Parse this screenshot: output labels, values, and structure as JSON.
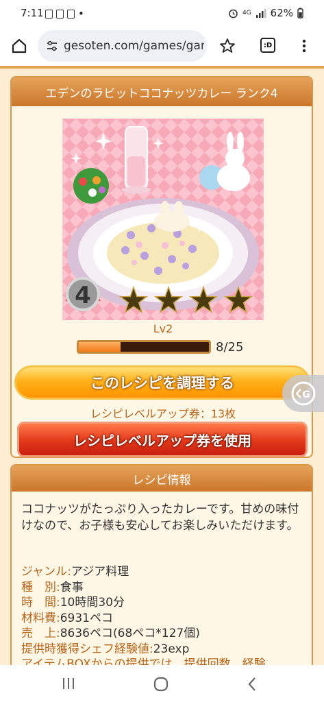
{
  "status": {
    "time": "7:11",
    "dot": "•",
    "network": "4G",
    "battery": "62%"
  },
  "browser": {
    "url": "gesoten.com/games/gar",
    "tabs_icon_label": ":D"
  },
  "recipe": {
    "title": "エデンのラビットココナッツカレー ランク4",
    "rank": "4",
    "stars": 4,
    "level": "Lv2",
    "progress_text": "8/25",
    "progress_fraction": 0.32,
    "cook_button": "このレシピを調理する",
    "ticket_text": "レシピレベルアップ券：13枚",
    "use_button": "レシピレベルアップ券を使用"
  },
  "info": {
    "header": "レシピ情報",
    "description": "ココナッツがたっぷり入ったカレーです。甘めの味付けなので、お子様も安心してお楽しみいただけます。",
    "specs": [
      {
        "label": "ジャンル:",
        "value": "アジア料理"
      },
      {
        "label": "種　別:",
        "value": "食事"
      },
      {
        "label": "時　間:",
        "value": "10時間30分"
      },
      {
        "label": "材料費:",
        "value": "6931ペコ"
      },
      {
        "label": "売　上:",
        "value": "8636ペコ(68ペコ*127個)"
      },
      {
        "label": "提供時獲得シェフ経験値:",
        "value": "23exp"
      },
      {
        "label": "アイテムBOXからの提供では、提供回数、経験",
        "value": ""
      }
    ]
  },
  "colors": {
    "accent": "#e08a2e",
    "title_bar": "#d28337",
    "cook_button": "#ffa31a",
    "use_button": "#e2381a"
  }
}
